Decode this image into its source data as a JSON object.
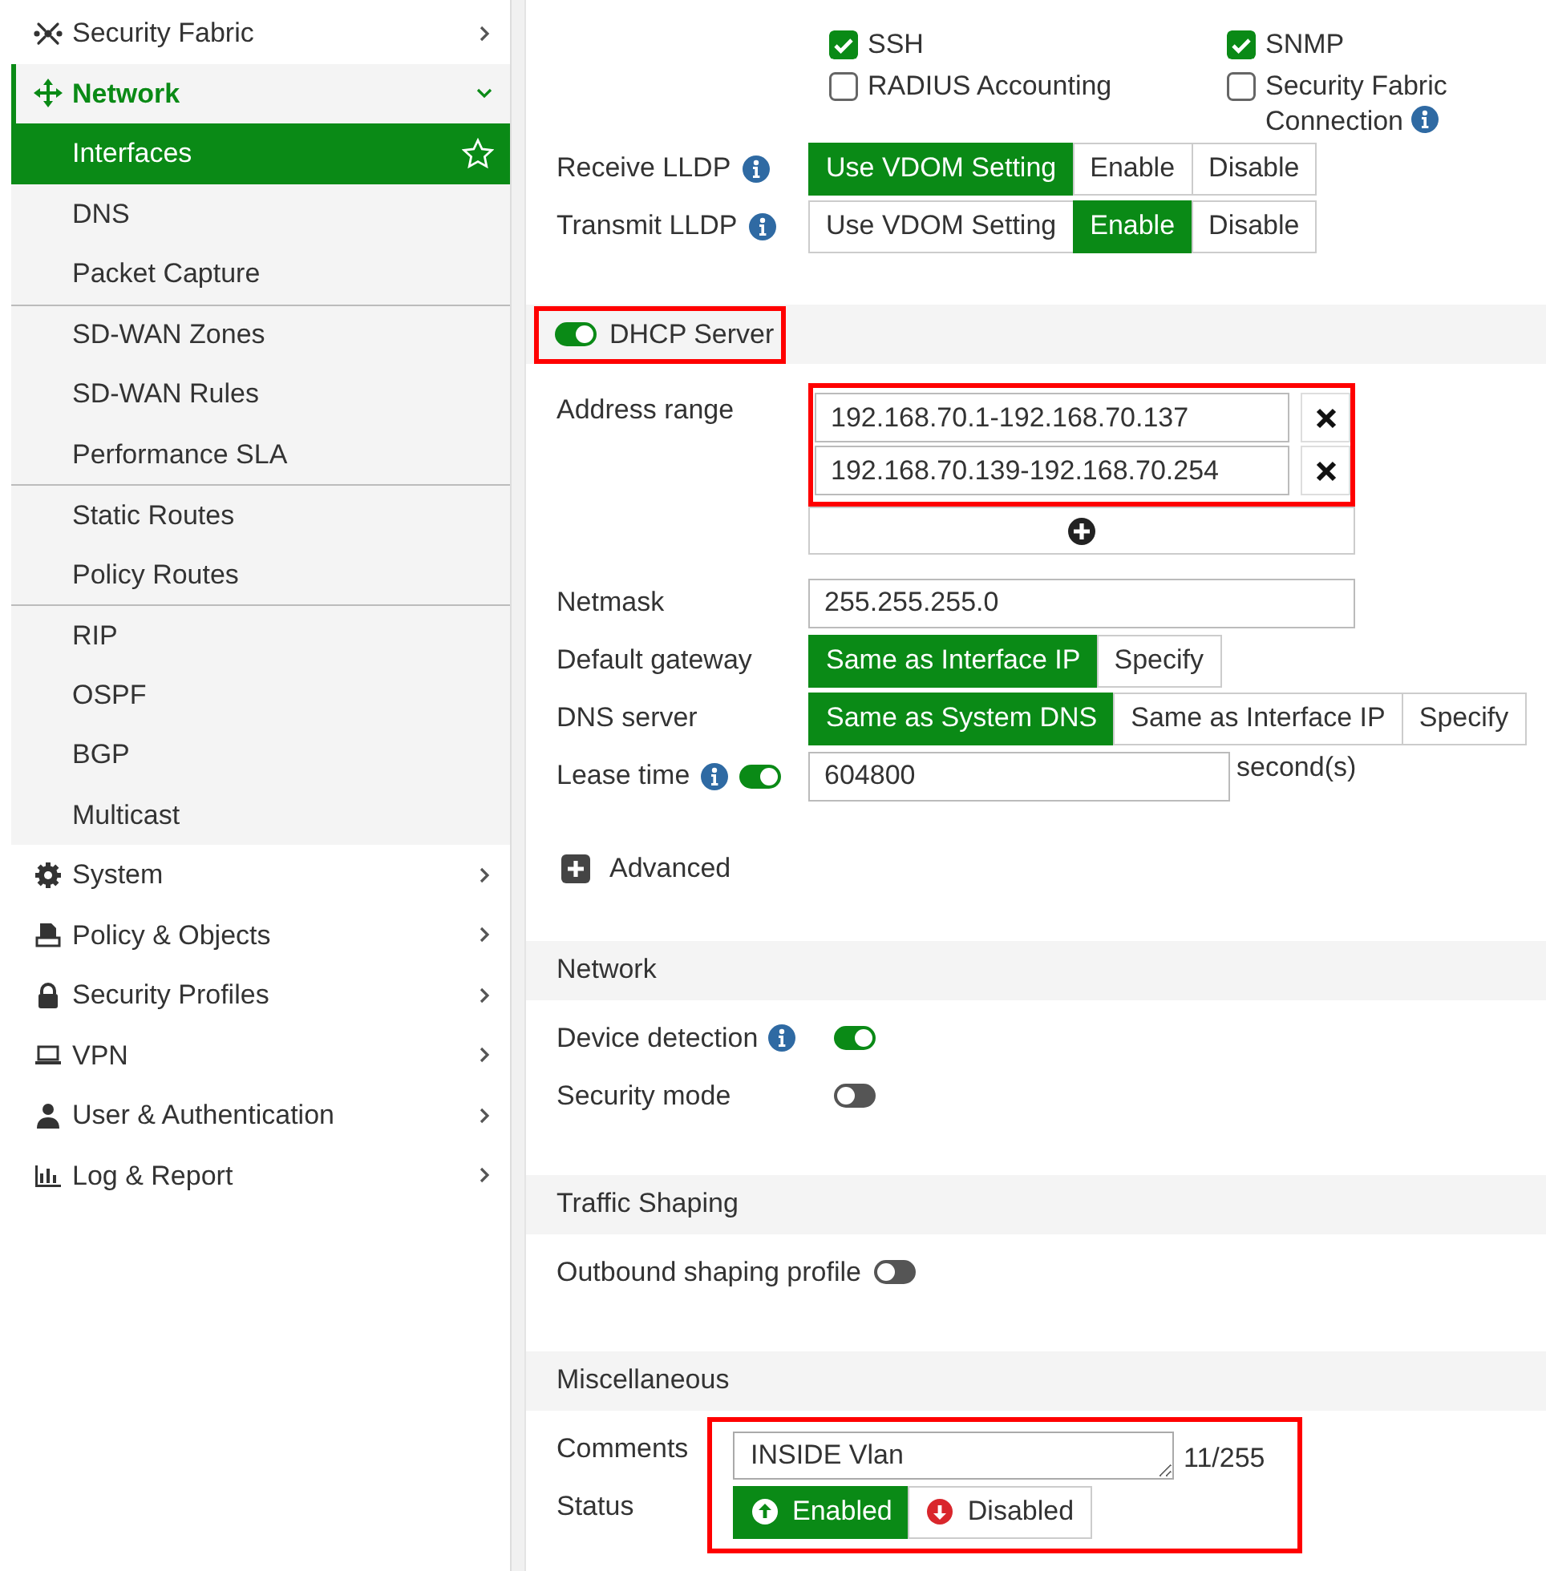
{
  "sidebar": {
    "items": [
      {
        "label": "Security Fabric",
        "expanded": false
      },
      {
        "label": "Network",
        "expanded": true,
        "children": [
          {
            "label": "Interfaces",
            "selected": true,
            "divider_above": false
          },
          {
            "label": "DNS",
            "selected": false,
            "divider_above": false
          },
          {
            "label": "Packet Capture",
            "selected": false,
            "divider_above": false
          },
          {
            "label": "SD-WAN Zones",
            "selected": false,
            "divider_above": true
          },
          {
            "label": "SD-WAN Rules",
            "selected": false,
            "divider_above": false
          },
          {
            "label": "Performance SLA",
            "selected": false,
            "divider_above": false
          },
          {
            "label": "Static Routes",
            "selected": false,
            "divider_above": true
          },
          {
            "label": "Policy Routes",
            "selected": false,
            "divider_above": false
          },
          {
            "label": "RIP",
            "selected": false,
            "divider_above": true
          },
          {
            "label": "OSPF",
            "selected": false,
            "divider_above": false
          },
          {
            "label": "BGP",
            "selected": false,
            "divider_above": false
          },
          {
            "label": "Multicast",
            "selected": false,
            "divider_above": false
          }
        ]
      },
      {
        "label": "System",
        "expanded": false
      },
      {
        "label": "Policy & Objects",
        "expanded": false
      },
      {
        "label": "Security Profiles",
        "expanded": false
      },
      {
        "label": "VPN",
        "expanded": false
      },
      {
        "label": "User & Authentication",
        "expanded": false
      },
      {
        "label": "Log & Report",
        "expanded": false
      }
    ]
  },
  "sections": [
    {
      "rows": [
        {
          "kind": "checkboxes",
          "options": [
            {
              "label": "SSH",
              "checked": true,
              "info": false
            },
            {
              "label": "SNMP",
              "checked": true,
              "info": false
            },
            {
              "label": "RADIUS Accounting",
              "checked": false,
              "info": false
            },
            {
              "label": "Security Fabric Connection",
              "checked": false,
              "info": true
            }
          ]
        },
        {
          "kind": "segmented",
          "label": "Receive LLDP",
          "info": true,
          "options": [
            {
              "label": "Use VDOM Setting",
              "selected": true
            },
            {
              "label": "Enable",
              "selected": false
            },
            {
              "label": "Disable",
              "selected": false
            }
          ]
        },
        {
          "kind": "segmented",
          "label": "Transmit LLDP",
          "info": true,
          "options": [
            {
              "label": "Use VDOM Setting",
              "selected": false
            },
            {
              "label": "Enable",
              "selected": true
            },
            {
              "label": "Disable",
              "selected": false
            }
          ]
        }
      ]
    },
    {
      "title": "DHCP Server",
      "on": true,
      "highlighted": true,
      "rows": [
        {
          "kind": "ranges",
          "label": "Address range",
          "highlighted": true,
          "values": [
            "192.168.70.1-192.168.70.137",
            "192.168.70.139-192.168.70.254"
          ]
        },
        {
          "kind": "text",
          "label": "Netmask",
          "value": "255.255.255.0"
        },
        {
          "kind": "segmented",
          "label": "Default gateway",
          "info": false,
          "options": [
            {
              "label": "Same as Interface IP",
              "selected": true
            },
            {
              "label": "Specify",
              "selected": false
            }
          ]
        },
        {
          "kind": "segmented",
          "label": "DNS server",
          "info": false,
          "options": [
            {
              "label": "Same as System DNS",
              "selected": true
            },
            {
              "label": "Same as Interface IP",
              "selected": false
            },
            {
              "label": "Specify",
              "selected": false
            }
          ]
        },
        {
          "kind": "lease",
          "label": "Lease time",
          "info": true,
          "on": true,
          "value": "604800",
          "unit": "second(s)"
        },
        {
          "kind": "expander",
          "label": "Advanced",
          "expanded": false
        }
      ]
    },
    {
      "title": "Network",
      "rows": [
        {
          "kind": "toggle",
          "label": "Device detection",
          "info": true,
          "on": true
        },
        {
          "kind": "toggle",
          "label": "Security mode",
          "info": false,
          "on": false
        }
      ]
    },
    {
      "title": "Traffic Shaping",
      "rows": [
        {
          "kind": "toggle",
          "label": "Outbound shaping profile",
          "info": false,
          "on": false
        }
      ]
    },
    {
      "title": "Miscellaneous",
      "rows": [
        {
          "kind": "group",
          "highlighted": true,
          "rows": [
            {
              "kind": "textarea",
              "label": "Comments",
              "value": "INSIDE Vlan",
              "counter": "11/255"
            },
            {
              "kind": "status",
              "label": "Status",
              "options": [
                {
                  "label": "Enabled",
                  "selected": true
                },
                {
                  "label": "Disabled",
                  "selected": false
                }
              ]
            }
          ]
        }
      ]
    }
  ]
}
